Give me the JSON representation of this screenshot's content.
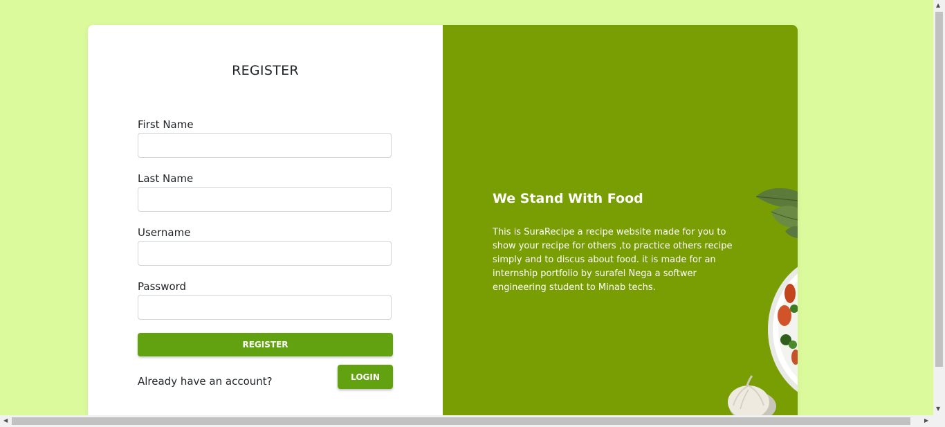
{
  "form": {
    "title": "REGISTER",
    "fields": [
      {
        "label": "First Name",
        "value": ""
      },
      {
        "label": "Last Name",
        "value": ""
      },
      {
        "label": "Username",
        "value": ""
      },
      {
        "label": "Password",
        "value": ""
      }
    ],
    "register_button": "REGISTER",
    "account_prompt": "Already have an account?",
    "login_button": "LOGIN"
  },
  "promo": {
    "heading": "We Stand With Food",
    "text": "This is SuraRecipe a recipe website made for you to show your recipe for others ,to practice others recipe simply and to discus about food. it is made for an internship portfolio by surafel Nega a softwer engineering student to Minab techs."
  },
  "icons": {
    "basil": "basil-leaves-image",
    "salad": "salad-bowl-image",
    "garlic": "garlic-image",
    "scroll_left": "scroll-left-arrow-icon",
    "scroll_right": "scroll-right-arrow-icon",
    "scroll_up": "scroll-up-arrow-icon",
    "scroll_down": "scroll-down-arrow-icon"
  },
  "colors": {
    "page_background": "#dafa9c",
    "promo_panel": "#799e04",
    "button": "#62a10f",
    "card": "#ffffff"
  }
}
